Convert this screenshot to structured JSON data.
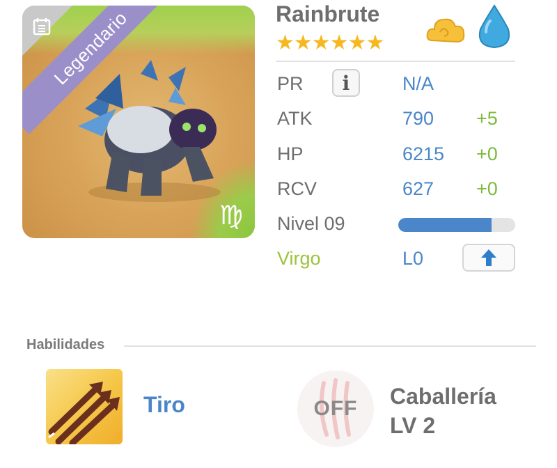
{
  "card": {
    "rarity": "Legendario"
  },
  "monster": {
    "name": "Rainbrute",
    "stars": "★★★★★★",
    "star_count": 6
  },
  "stats": {
    "pr": {
      "label": "PR",
      "value": "N/A"
    },
    "atk": {
      "label": "ATK",
      "value": "790",
      "bonus": "+5"
    },
    "hp": {
      "label": "HP",
      "value": "6215",
      "bonus": "+0"
    },
    "rcv": {
      "label": "RCV",
      "value": "627",
      "bonus": "+0"
    },
    "level": {
      "label": "Nivel 09",
      "progress": 0.8
    },
    "zodiac": {
      "label": "Virgo",
      "value": "L0"
    }
  },
  "skills": {
    "title": "Habilidades",
    "items": [
      {
        "name": "Tiro"
      },
      {
        "status": "OFF",
        "name_line1": "Caballería",
        "name_line2": "LV 2"
      }
    ]
  },
  "colors": {
    "accent_blue": "#4a86c9",
    "bonus_green": "#7dbb3c",
    "star_yellow": "#f5b820",
    "rarity_purple": "#9b8fca"
  },
  "icons": {
    "zodiac": "virgo-icon",
    "element1": "cloud-icon",
    "element2": "water-drop-icon",
    "info": "info-icon",
    "upgrade": "arrow-up-icon"
  }
}
